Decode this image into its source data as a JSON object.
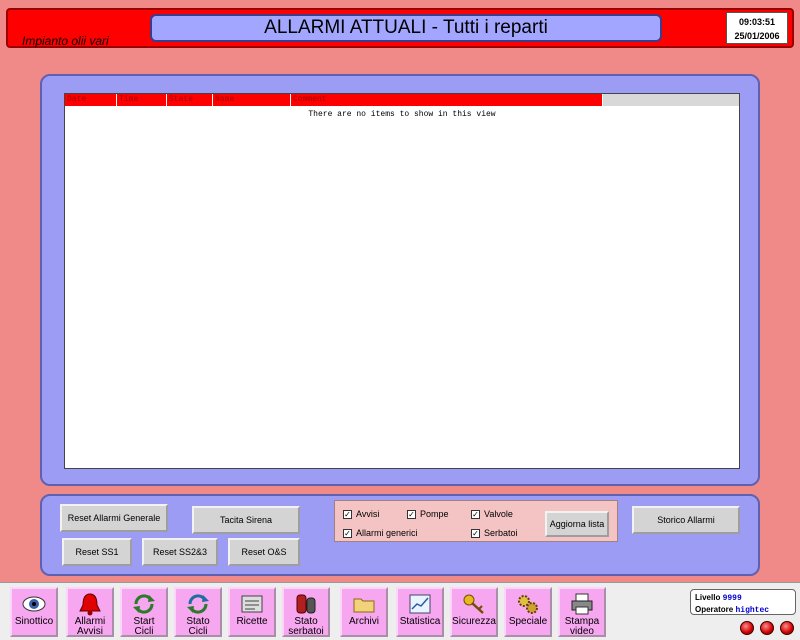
{
  "header": {
    "plant_name": "Impianto olii vari",
    "title": "ALLARMI ATTUALI - Tutti i reparti",
    "time": "09:03:51",
    "date": "25/01/2006"
  },
  "alarm_list": {
    "columns": [
      "Date",
      "Time",
      "State",
      "Name",
      "Comment"
    ],
    "empty_message": "There are no items to show in this view"
  },
  "controls": {
    "reset_general": "Reset Allarmi Generale",
    "mute_siren": "Tacita Sirena",
    "reset_ss1": "Reset SS1",
    "reset_ss23": "Reset SS2&3",
    "reset_os": "Reset O&S",
    "refresh_list": "Aggiorna lista",
    "alarm_history": "Storico Allarmi",
    "filters": [
      {
        "label": "Avvisi",
        "checked": true
      },
      {
        "label": "Pompe",
        "checked": true
      },
      {
        "label": "Valvole",
        "checked": true
      },
      {
        "label": "Allarmi generici",
        "checked": true
      },
      {
        "label": "Serbatoi",
        "checked": true
      }
    ],
    "check_mark": "✓"
  },
  "nav": {
    "items": [
      {
        "label": "Sinottico",
        "icon": "eye-icon"
      },
      {
        "label": "Allarmi\nAvvisi",
        "icon": "bell-icon"
      },
      {
        "label": "Start\nCicli",
        "icon": "cycle-arrows-icon"
      },
      {
        "label": "Stato\nCicli",
        "icon": "cycle-status-icon"
      },
      {
        "label": "Ricette",
        "icon": "recipe-icon"
      },
      {
        "label": "Stato\nserbatoi",
        "icon": "tank-icon"
      },
      {
        "label": "Archivi",
        "icon": "folder-icon"
      },
      {
        "label": "Statistica",
        "icon": "chart-icon"
      },
      {
        "label": "Sicurezza",
        "icon": "keys-icon"
      },
      {
        "label": "Speciale",
        "icon": "gears-icon"
      },
      {
        "label": "Stampa\nvideo",
        "icon": "printer-icon"
      }
    ]
  },
  "user": {
    "level_label": "Livello",
    "level_value": "9999",
    "operator_label": "Operatore",
    "operator_value": "hightec"
  },
  "colors": {
    "background": "#f08a88",
    "header_red": "#ff0000",
    "panel_blue": "#9c9cf4",
    "nav_pink": "#f7a6f0"
  }
}
